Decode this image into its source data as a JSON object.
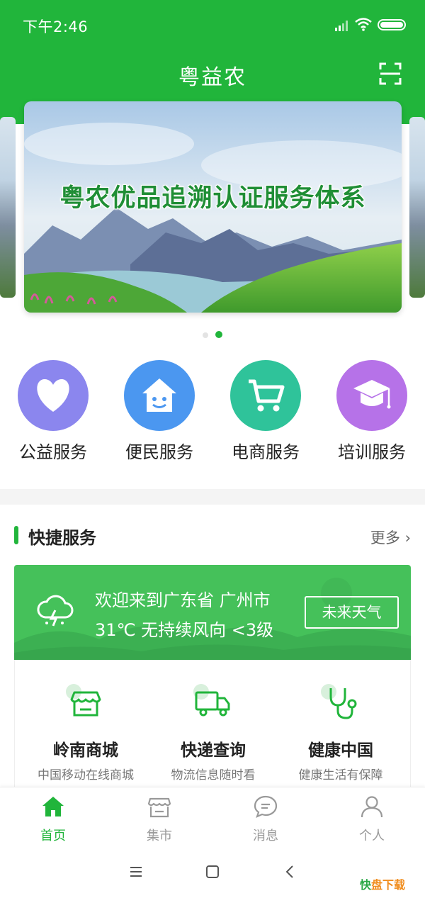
{
  "status_bar": {
    "time": "下午2:46"
  },
  "header": {
    "title": "粤益农"
  },
  "banner": {
    "caption": "粤农优品追溯认证服务体系"
  },
  "services": [
    {
      "label": "公益服务",
      "color": "#8b86ee",
      "icon": "heart-icon"
    },
    {
      "label": "便民服务",
      "color": "#4b97f0",
      "icon": "house-smile-icon"
    },
    {
      "label": "电商服务",
      "color": "#2fc39a",
      "icon": "cart-icon"
    },
    {
      "label": "培训服务",
      "color": "#b672e8",
      "icon": "graduation-cap-icon"
    }
  ],
  "quick_service": {
    "title": "快捷服务",
    "more": "更多",
    "weather": {
      "line1": "欢迎来到广东省 广州市",
      "line2": "31℃ 无持续风向 <3级",
      "button": "未来天气"
    },
    "shops": [
      {
        "name": "岭南商城",
        "desc": "中国移动在线商城",
        "icon": "store-icon"
      },
      {
        "name": "快递查询",
        "desc": "物流信息随时看",
        "icon": "truck-icon"
      },
      {
        "name": "健康中国",
        "desc": "健康生活有保障",
        "icon": "stethoscope-icon"
      }
    ]
  },
  "tabs": [
    {
      "label": "首页",
      "active": true,
      "icon": "home-icon"
    },
    {
      "label": "集市",
      "active": false,
      "icon": "market-icon"
    },
    {
      "label": "消息",
      "active": false,
      "icon": "message-icon"
    },
    {
      "label": "个人",
      "active": false,
      "icon": "person-icon"
    }
  ],
  "watermark": {
    "k": "快",
    "rest": "盘下载"
  },
  "colors": {
    "brand": "#21b53b",
    "weather_bg": "#45c15a"
  }
}
